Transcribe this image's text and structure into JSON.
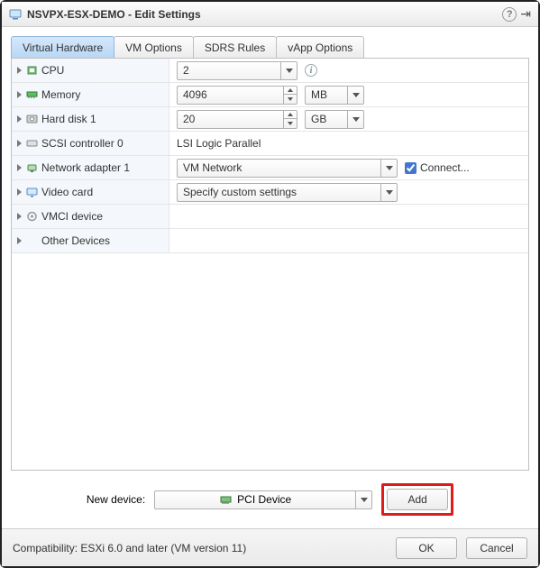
{
  "title": "NSVPX-ESX-DEMO - Edit Settings",
  "tabs": [
    "Virtual Hardware",
    "VM Options",
    "SDRS Rules",
    "vApp Options"
  ],
  "rows": {
    "cpu": {
      "label": "CPU",
      "value": "2"
    },
    "memory": {
      "label": "Memory",
      "value": "4096",
      "unit": "MB"
    },
    "disk": {
      "label": "Hard disk 1",
      "value": "20",
      "unit": "GB"
    },
    "scsi": {
      "label": "SCSI controller 0",
      "value": "LSI Logic Parallel"
    },
    "net": {
      "label": "Network adapter 1",
      "value": "VM Network",
      "connect": "Connect..."
    },
    "video": {
      "label": "Video card",
      "value": "Specify custom settings"
    },
    "vmci": {
      "label": "VMCI device"
    },
    "other": {
      "label": "Other Devices"
    }
  },
  "newdevice": {
    "label": "New device:",
    "value": "PCI Device",
    "add": "Add"
  },
  "footer": {
    "compat": "Compatibility: ESXi 6.0 and later (VM version 11)",
    "ok": "OK",
    "cancel": "Cancel"
  }
}
